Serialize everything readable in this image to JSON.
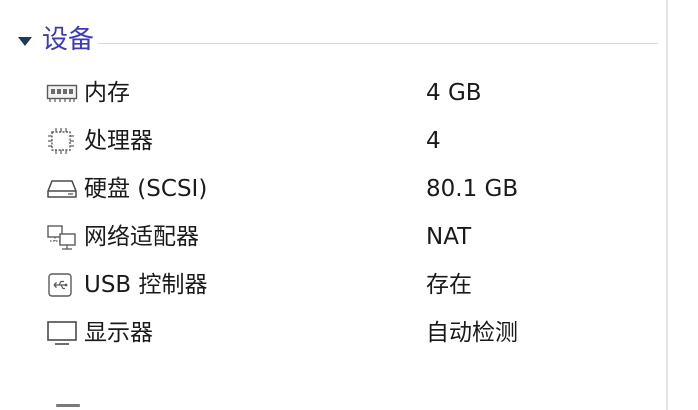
{
  "section": {
    "title": "设备",
    "expanded_icon": "caret-down-icon"
  },
  "devices": [
    {
      "icon": "memory-icon",
      "label": "内存",
      "value": "4 GB"
    },
    {
      "icon": "cpu-icon",
      "label": "处理器",
      "value": "4"
    },
    {
      "icon": "hard-disk-icon",
      "label": "硬盘 (SCSI)",
      "value": "80.1 GB"
    },
    {
      "icon": "network-adapter-icon",
      "label": "网络适配器",
      "value": "NAT"
    },
    {
      "icon": "usb-icon",
      "label": "USB 控制器",
      "value": "存在"
    },
    {
      "icon": "display-icon",
      "label": "显示器",
      "value": "自动检测"
    }
  ],
  "colors": {
    "section_title": "#3d3ab5",
    "caret": "#1f3a5f",
    "text": "#1a1a1a",
    "divider": "#d9d9d9"
  }
}
